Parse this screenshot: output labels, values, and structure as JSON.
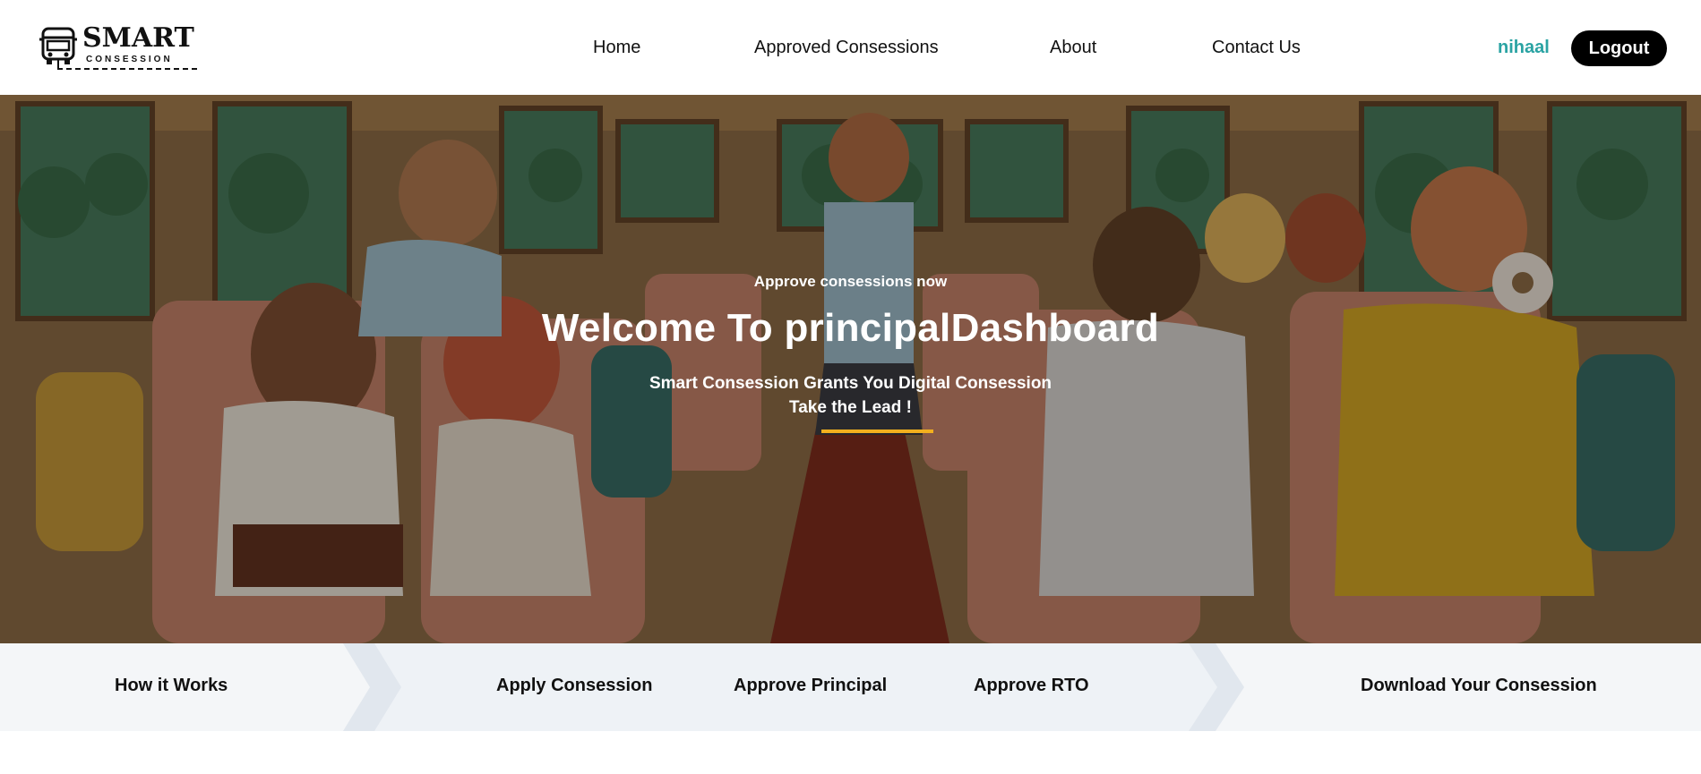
{
  "logo": {
    "title": "SMART",
    "subtitle": "CONSESSION",
    "icon": "bus-icon"
  },
  "nav": {
    "home": "Home",
    "approved": "Approved Consessions",
    "about": "About",
    "contact": "Contact Us",
    "user": "nihaal",
    "logout": "Logout"
  },
  "hero": {
    "kicker": "Approve consessions now",
    "title": "Welcome To principalDashboard",
    "line1": "Smart Consession Grants You Digital Consession",
    "line2": "Take the Lead !",
    "accent_color": "#f2b01e"
  },
  "steps": {
    "how": "How it Works",
    "apply": "Apply Consession",
    "principal": "Approve Principal",
    "rto": "Approve RTO",
    "download": "Download Your Consession"
  },
  "colors": {
    "user": "#2aa3a3",
    "logout_bg": "#000000",
    "steps_bg": "#f4f6f8"
  }
}
